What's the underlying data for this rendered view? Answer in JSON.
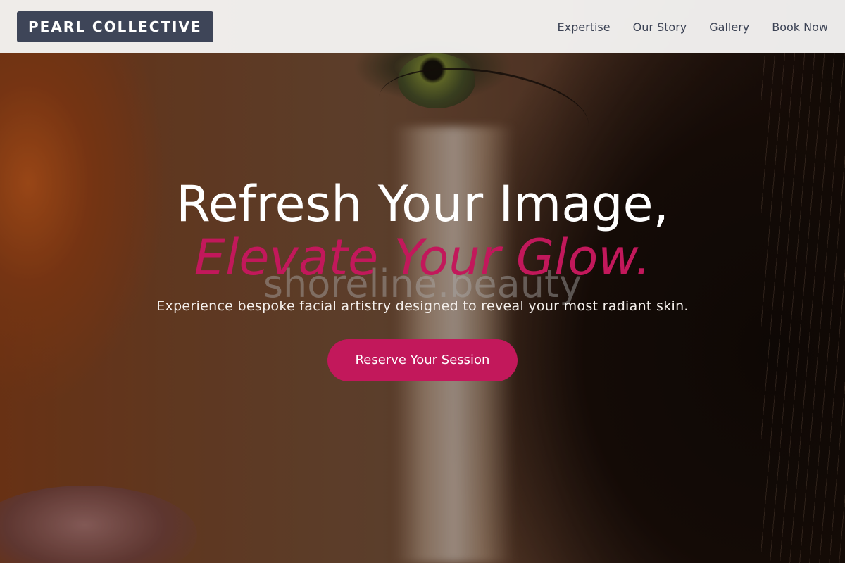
{
  "brand": {
    "logo_text": "PEARL COLLECTIVE"
  },
  "nav": {
    "items": [
      {
        "label": "Expertise"
      },
      {
        "label": "Our Story"
      },
      {
        "label": "Gallery"
      },
      {
        "label": "Book Now"
      }
    ]
  },
  "hero": {
    "title_line1": "Refresh Your Image,",
    "title_line2": "Elevate Your Glow.",
    "watermark": "shoreline.beauty",
    "subtitle": "Experience bespoke facial artistry designed to reveal your most radiant skin.",
    "cta_label": "Reserve Your Session"
  },
  "colors": {
    "accent": "#c2185b",
    "logo_bg": "#3e4558",
    "header_bg": "#f5f4f3",
    "nav_text": "#3b4254"
  }
}
